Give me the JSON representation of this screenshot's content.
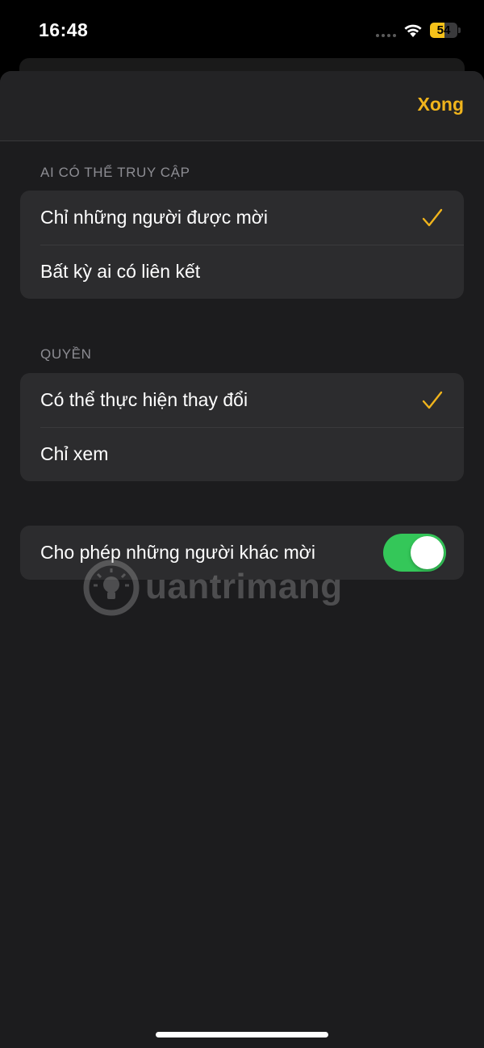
{
  "status_bar": {
    "time": "16:48",
    "battery_level": "54",
    "battery_fraction": 0.54,
    "battery_color": "#f6c21a",
    "wifi_icon": "wifi-icon"
  },
  "nav": {
    "done_label": "Xong",
    "accent_color": "#f0b41c"
  },
  "access": {
    "header": "AI CÓ THỂ TRUY CẬP",
    "options": [
      {
        "label": "Chỉ những người được mời",
        "selected": true
      },
      {
        "label": "Bất kỳ ai có liên kết",
        "selected": false
      }
    ]
  },
  "permission": {
    "header": "QUYỀN",
    "options": [
      {
        "label": "Có thể thực hiện thay đổi",
        "selected": true
      },
      {
        "label": "Chỉ xem",
        "selected": false
      }
    ]
  },
  "allow_invite": {
    "label": "Cho phép những người khác mời",
    "enabled": true,
    "toggle_color": "#34c759"
  },
  "watermark": {
    "text": "uantrimang"
  }
}
